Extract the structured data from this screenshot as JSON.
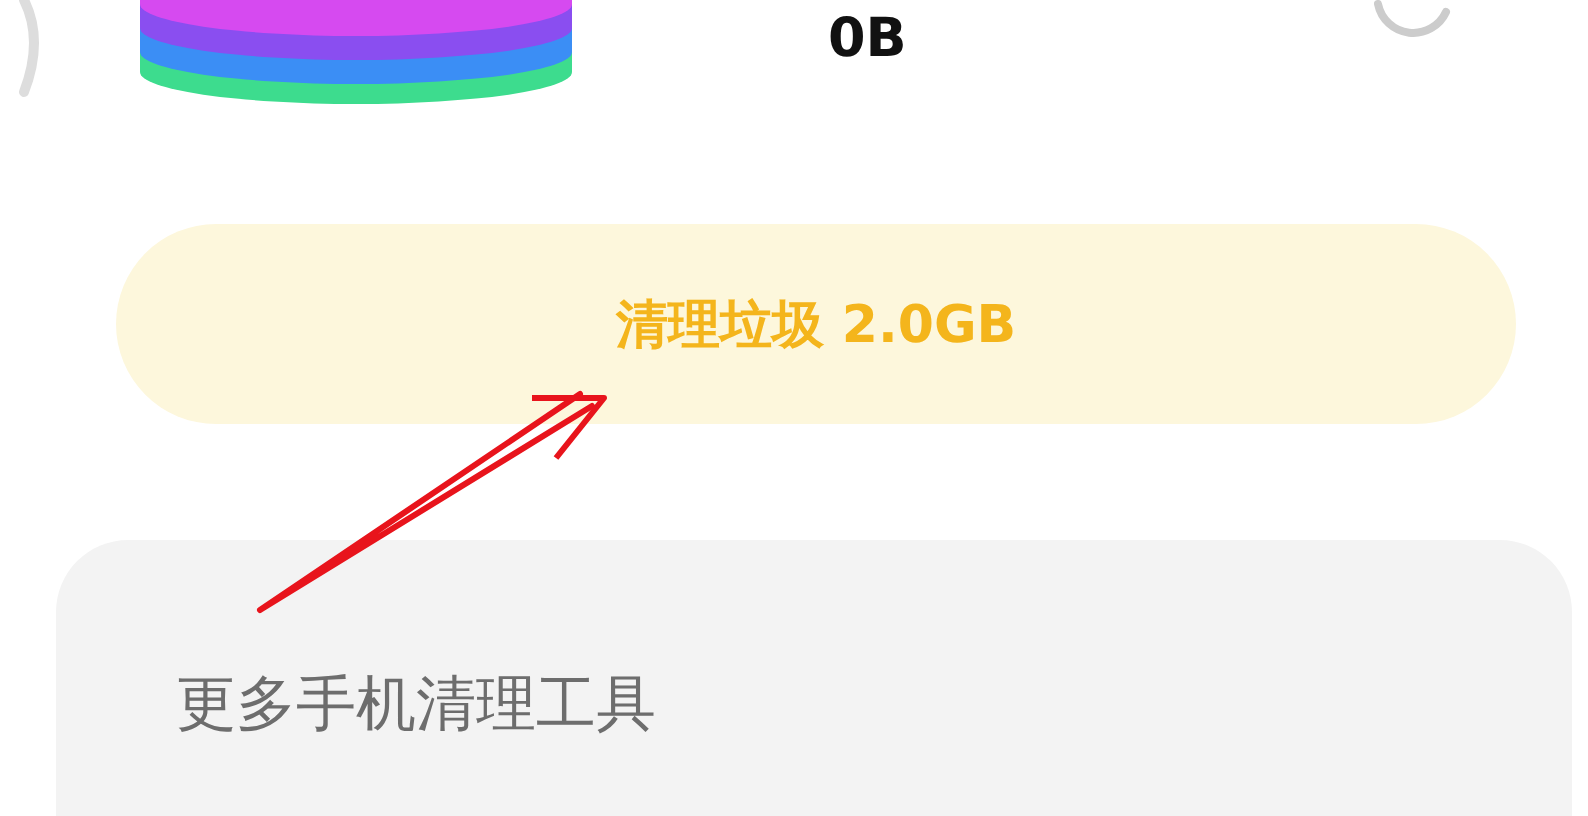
{
  "storage": {
    "size": "0B"
  },
  "clean_button": {
    "label": "清理垃圾 2.0GB"
  },
  "tools_card": {
    "title": "更多手机清理工具"
  }
}
